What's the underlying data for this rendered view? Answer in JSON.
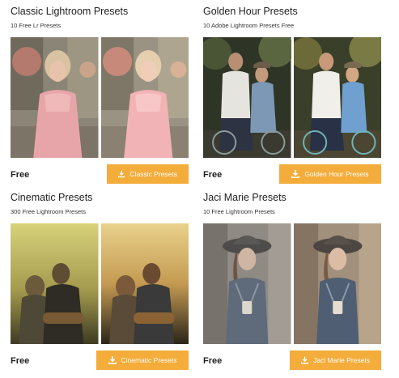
{
  "cards": [
    {
      "title": "Classic Lightroom Presets",
      "subtitle": "10 Free Lr Presets",
      "price": "Free",
      "button_label": "Classic Presets",
      "images": [
        "portrait-before",
        "portrait-after"
      ]
    },
    {
      "title": "Golden Hour Presets",
      "subtitle": "10 Adobe Lightroom Presets Free",
      "price": "Free",
      "button_label": "Golden Hour Presets",
      "images": [
        "couple-bicycle-before",
        "couple-bicycle-after"
      ]
    },
    {
      "title": "Cinematic Presets",
      "subtitle": "300 Free Lightroom Presets",
      "price": "Free",
      "button_label": "Cinematic Presets",
      "images": [
        "couple-guitar-before",
        "couple-guitar-after"
      ]
    },
    {
      "title": "Jaci Marie Presets",
      "subtitle": "10 Free Lightroom Presets",
      "price": "Free",
      "button_label": "Jaci Marie Presets",
      "images": [
        "woman-hat-before",
        "woman-hat-after"
      ]
    }
  ],
  "colors": {
    "button_bg": "#f4ac3a",
    "button_text": "#ffffff",
    "title_text": "#222222"
  },
  "icons": {
    "button_icon": "download-icon"
  }
}
